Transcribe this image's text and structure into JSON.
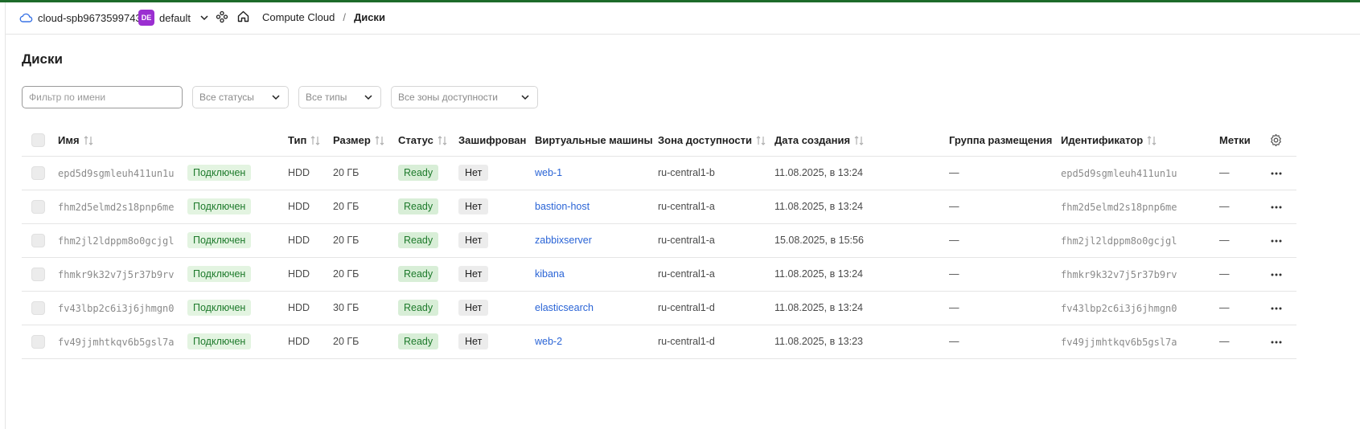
{
  "header": {
    "cloud_name": "cloud-spb9673599743",
    "folder_badge": "DE",
    "folder_name": "default",
    "breadcrumb": {
      "service": "Compute Cloud",
      "separator": "/",
      "current": "Диски"
    }
  },
  "page": {
    "title": "Диски"
  },
  "filters": {
    "name_placeholder": "Фильтр по имени",
    "status_select": "Все статусы",
    "type_select": "Все типы",
    "zone_select": "Все зоны доступности"
  },
  "table": {
    "columns": {
      "name": "Имя",
      "type": "Тип",
      "size": "Размер",
      "status": "Статус",
      "encrypted": "Зашифрован",
      "vms": "Виртуальные машины",
      "zone": "Зона доступности",
      "created": "Дата создания",
      "placement": "Группа размещения",
      "id": "Идентификатор",
      "labels": "Метки"
    },
    "rows": [
      {
        "name": "epd5d9sgmleuh411un1u",
        "attached": "Подключен",
        "type": "HDD",
        "size": "20 ГБ",
        "status": "Ready",
        "encrypted": "Нет",
        "vm": "web-1",
        "zone": "ru-central1-b",
        "created": "11.08.2025, в 13:24",
        "placement": "—",
        "id": "epd5d9sgmleuh411un1u",
        "labels": "—"
      },
      {
        "name": "fhm2d5elmd2s18pnp6me",
        "attached": "Подключен",
        "type": "HDD",
        "size": "20 ГБ",
        "status": "Ready",
        "encrypted": "Нет",
        "vm": "bastion-host",
        "zone": "ru-central1-a",
        "created": "11.08.2025, в 13:24",
        "placement": "—",
        "id": "fhm2d5elmd2s18pnp6me",
        "labels": "—"
      },
      {
        "name": "fhm2jl2ldppm8o0gcjgl",
        "attached": "Подключен",
        "type": "HDD",
        "size": "20 ГБ",
        "status": "Ready",
        "encrypted": "Нет",
        "vm": "zabbixserver",
        "zone": "ru-central1-a",
        "created": "15.08.2025, в 15:56",
        "placement": "—",
        "id": "fhm2jl2ldppm8o0gcjgl",
        "labels": "—"
      },
      {
        "name": "fhmkr9k32v7j5r37b9rv",
        "attached": "Подключен",
        "type": "HDD",
        "size": "20 ГБ",
        "status": "Ready",
        "encrypted": "Нет",
        "vm": "kibana",
        "zone": "ru-central1-a",
        "created": "11.08.2025, в 13:24",
        "placement": "—",
        "id": "fhmkr9k32v7j5r37b9rv",
        "labels": "—"
      },
      {
        "name": "fv43lbp2c6i3j6jhmgn0",
        "attached": "Подключен",
        "type": "HDD",
        "size": "30 ГБ",
        "status": "Ready",
        "encrypted": "Нет",
        "vm": "elasticsearch",
        "zone": "ru-central1-d",
        "created": "11.08.2025, в 13:24",
        "placement": "—",
        "id": "fv43lbp2c6i3j6jhmgn0",
        "labels": "—"
      },
      {
        "name": "fv49jjmhtkqv6b5gsl7a",
        "attached": "Подключен",
        "type": "HDD",
        "size": "20 ГБ",
        "status": "Ready",
        "encrypted": "Нет",
        "vm": "web-2",
        "zone": "ru-central1-d",
        "created": "11.08.2025, в 13:23",
        "placement": "—",
        "id": "fv49jjmhtkqv6b5gsl7a",
        "labels": "—"
      }
    ]
  }
}
